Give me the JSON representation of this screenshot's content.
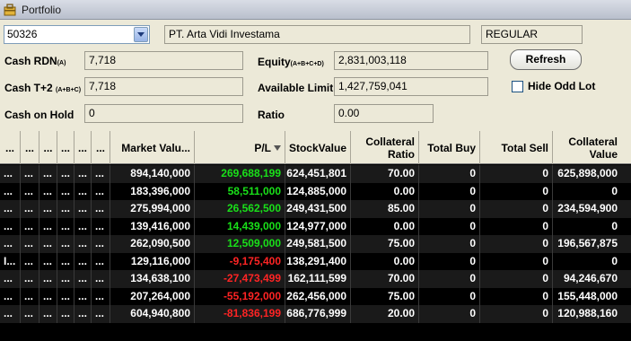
{
  "window": {
    "title": "Portfolio"
  },
  "account": {
    "code": "50326",
    "name": "PT. Arta Vidi Investama",
    "type": "REGULAR"
  },
  "fields": {
    "cash_rdn": {
      "label": "Cash RDN",
      "sub": "(A)",
      "value": "7,718"
    },
    "cash_t2": {
      "label": "Cash T+2",
      "sub": "(A+B+C)",
      "value": "7,718"
    },
    "cash_hold": {
      "label": "Cash on Hold",
      "value": "0"
    },
    "equity": {
      "label": "Equity",
      "sub": "(A+B+C+D)",
      "value": "2,831,003,118"
    },
    "available": {
      "label": "Available Limit",
      "value": "1,427,759,041"
    },
    "ratio": {
      "label": "Ratio",
      "value": "0.00"
    }
  },
  "buttons": {
    "refresh": "Refresh"
  },
  "options": {
    "hide_odd_lot": "Hide Odd Lot"
  },
  "columns": {
    "small": [
      "...",
      "...",
      "...",
      "...",
      "...",
      "..."
    ],
    "market_value": "Market Valu...",
    "pl": "P/L",
    "stock_value": "StockValue",
    "collateral_ratio": "Collateral Ratio",
    "total_buy": "Total Buy",
    "total_sell": "Total Sell",
    "collateral_value": "Collateral Value"
  },
  "rows": [
    {
      "c0": "...",
      "c1": "...",
      "c2": "...",
      "c3": "...",
      "c4": "...",
      "c5": "...",
      "market": "894,140,000",
      "pl": "269,688,199",
      "sign": "pos",
      "stock": "624,451,801",
      "ratio": "70.00",
      "buy": "0",
      "sell": "0",
      "coll": "625,898,000"
    },
    {
      "c0": "...",
      "c1": "...",
      "c2": "...",
      "c3": "...",
      "c4": "...",
      "c5": "...",
      "market": "183,396,000",
      "pl": "58,511,000",
      "sign": "pos",
      "stock": "124,885,000",
      "ratio": "0.00",
      "buy": "0",
      "sell": "0",
      "coll": "0"
    },
    {
      "c0": "...",
      "c1": "...",
      "c2": "...",
      "c3": "...",
      "c4": "...",
      "c5": "...",
      "market": "275,994,000",
      "pl": "26,562,500",
      "sign": "pos",
      "stock": "249,431,500",
      "ratio": "85.00",
      "buy": "0",
      "sell": "0",
      "coll": "234,594,900"
    },
    {
      "c0": "...",
      "c1": "...",
      "c2": "...",
      "c3": "...",
      "c4": "...",
      "c5": "...",
      "market": "139,416,000",
      "pl": "14,439,000",
      "sign": "pos",
      "stock": "124,977,000",
      "ratio": "0.00",
      "buy": "0",
      "sell": "0",
      "coll": "0"
    },
    {
      "c0": "...",
      "c1": "...",
      "c2": "...",
      "c3": "...",
      "c4": "...",
      "c5": "...",
      "market": "262,090,500",
      "pl": "12,509,000",
      "sign": "pos",
      "stock": "249,581,500",
      "ratio": "75.00",
      "buy": "0",
      "sell": "0",
      "coll": "196,567,875"
    },
    {
      "c0": "I...",
      "c1": "...",
      "c2": "...",
      "c3": "...",
      "c4": "...",
      "c5": "...",
      "market": "129,116,000",
      "pl": "-9,175,400",
      "sign": "neg",
      "stock": "138,291,400",
      "ratio": "0.00",
      "buy": "0",
      "sell": "0",
      "coll": "0"
    },
    {
      "c0": "...",
      "c1": "...",
      "c2": "...",
      "c3": "...",
      "c4": "...",
      "c5": "...",
      "market": "134,638,100",
      "pl": "-27,473,499",
      "sign": "neg",
      "stock": "162,111,599",
      "ratio": "70.00",
      "buy": "0",
      "sell": "0",
      "coll": "94,246,670"
    },
    {
      "c0": "...",
      "c1": "...",
      "c2": "...",
      "c3": "...",
      "c4": "...",
      "c5": "...",
      "market": "207,264,000",
      "pl": "-55,192,000",
      "sign": "neg",
      "stock": "262,456,000",
      "ratio": "75.00",
      "buy": "0",
      "sell": "0",
      "coll": "155,448,000"
    },
    {
      "c0": "...",
      "c1": "...",
      "c2": "...",
      "c3": "...",
      "c4": "...",
      "c5": "...",
      "market": "604,940,800",
      "pl": "-81,836,199",
      "sign": "neg",
      "stock": "686,776,999",
      "ratio": "20.00",
      "buy": "0",
      "sell": "0",
      "coll": "120,988,160"
    }
  ],
  "colors": {
    "positive": "#19e019",
    "negative": "#ff2424",
    "panel": "#ece9d8"
  },
  "icons": {
    "app": "portfolio-window-icon",
    "dropdown": "chevron-down-icon",
    "sort": "sort-desc-icon"
  }
}
